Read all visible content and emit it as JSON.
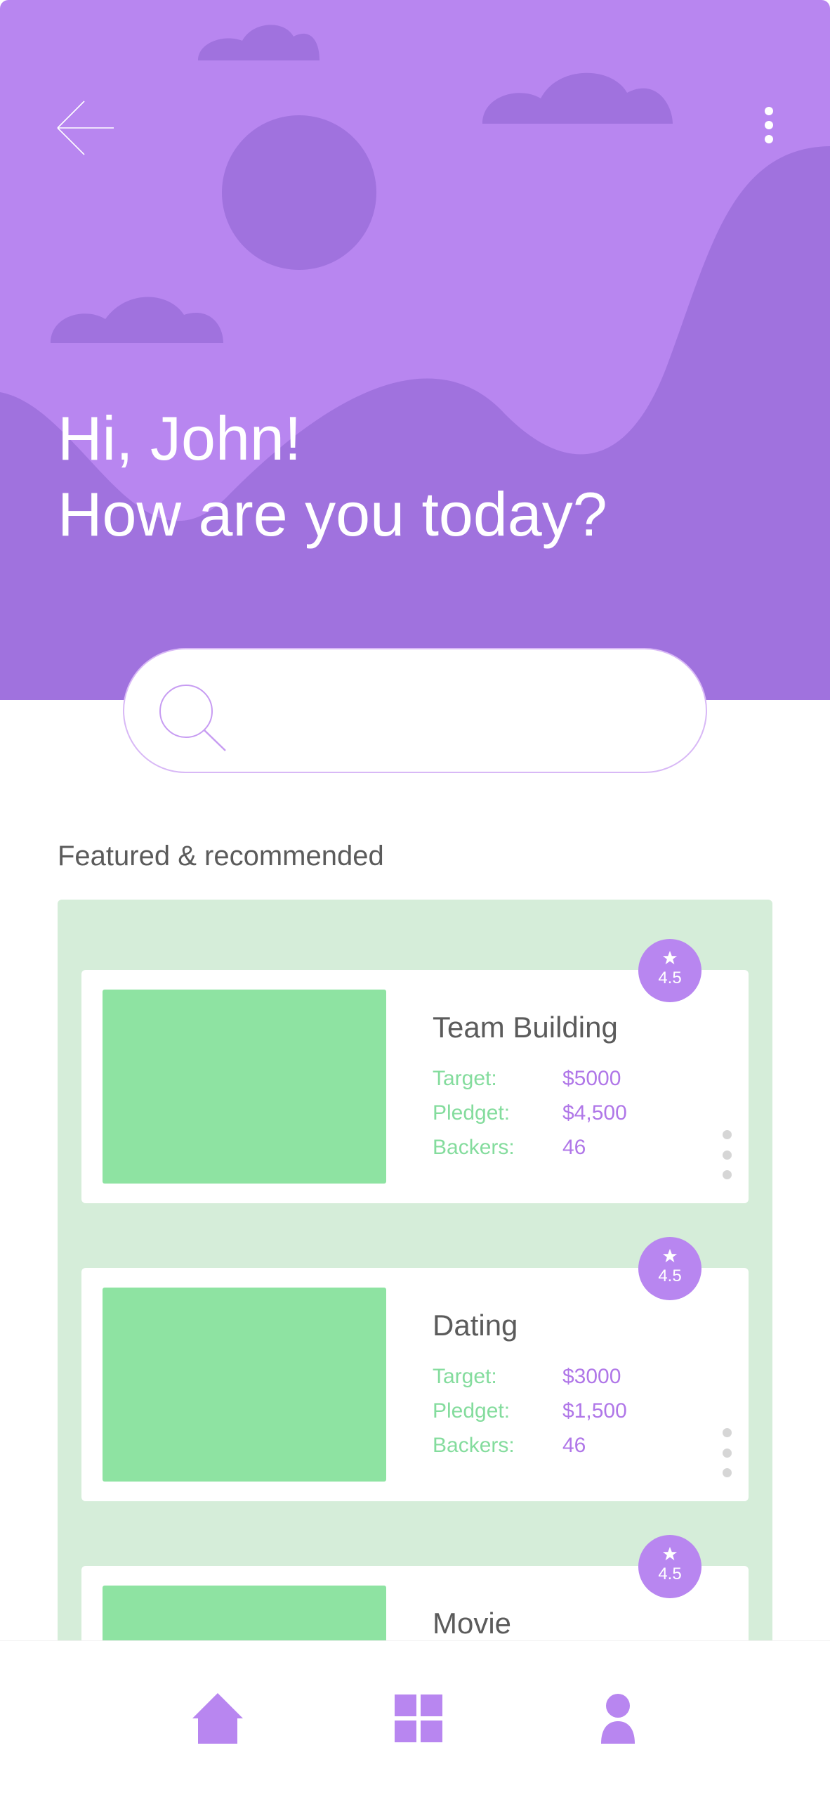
{
  "colors": {
    "header_bg": "#b886f0",
    "header_shape": "#a072de",
    "accent": "#b886f0",
    "panel_bg": "#d5edd9",
    "thumbnail": "#8ee3a2",
    "label_green": "#84dc9d",
    "value_purple": "#b077e8",
    "text_dark": "#5b5b5b"
  },
  "header": {
    "back_icon": "arrow-left-icon",
    "menu_icon": "more-vertical-icon",
    "greeting_line1": "Hi, John!",
    "greeting_line2": "How are you today?"
  },
  "search": {
    "icon": "search-icon",
    "value": "",
    "placeholder": ""
  },
  "featured": {
    "title": "Featured & recommended",
    "cards": [
      {
        "title": "Team Building",
        "rating": "4.5",
        "stats": [
          {
            "label": "Target:",
            "value": "$5000"
          },
          {
            "label": "Pledget:",
            "value": "$4,500"
          },
          {
            "label": "Backers:",
            "value": "46"
          }
        ]
      },
      {
        "title": "Dating",
        "rating": "4.5",
        "stats": [
          {
            "label": "Target:",
            "value": "$3000"
          },
          {
            "label": "Pledget:",
            "value": "$1,500"
          },
          {
            "label": "Backers:",
            "value": "46"
          }
        ]
      },
      {
        "title": "Movie",
        "rating": "4.5",
        "stats": []
      }
    ]
  },
  "bottom_nav": [
    {
      "icon": "home-icon"
    },
    {
      "icon": "grid-icon"
    },
    {
      "icon": "user-icon"
    }
  ]
}
